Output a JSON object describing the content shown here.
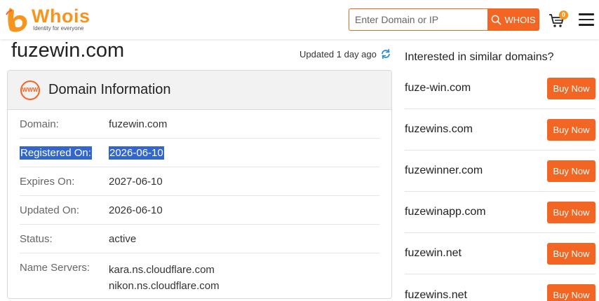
{
  "header": {
    "logo_word": "Whois",
    "logo_tagline": "Identity for everyone",
    "search_placeholder": "Enter Domain or IP",
    "search_button_label": "WHOIS",
    "cart_count": "0"
  },
  "main": {
    "domain": "fuzewin.com",
    "updated_text": "Updated 1 day ago",
    "panel_title": "Domain Information",
    "rows": [
      {
        "label": "Domain:",
        "value": "fuzewin.com"
      },
      {
        "label": "Registered On:",
        "value": "2026-06-10"
      },
      {
        "label": "Expires On:",
        "value": "2027-06-10"
      },
      {
        "label": "Updated On:",
        "value": "2026-06-10"
      },
      {
        "label": "Status:",
        "value": "active"
      },
      {
        "label": "Name Servers:",
        "values": [
          "kara.ns.cloudflare.com",
          "nikon.ns.cloudflare.com"
        ]
      }
    ]
  },
  "sidebar": {
    "title": "Interested in similar domains?",
    "buy_label": "Buy Now",
    "items": [
      {
        "name": "fuze-win.com"
      },
      {
        "name": "fuzewins.com"
      },
      {
        "name": "fuzewinner.com"
      },
      {
        "name": "fuzewinapp.com"
      },
      {
        "name": "fuzewin.net"
      },
      {
        "name": "fuzewins.net"
      }
    ]
  },
  "colors": {
    "accent": "#f26522",
    "logo": "#f7941d",
    "selection": "#3366cc"
  },
  "icons": [
    "logo-icon",
    "search-icon",
    "cart-icon",
    "menu-icon",
    "refresh-icon",
    "www-icon"
  ]
}
